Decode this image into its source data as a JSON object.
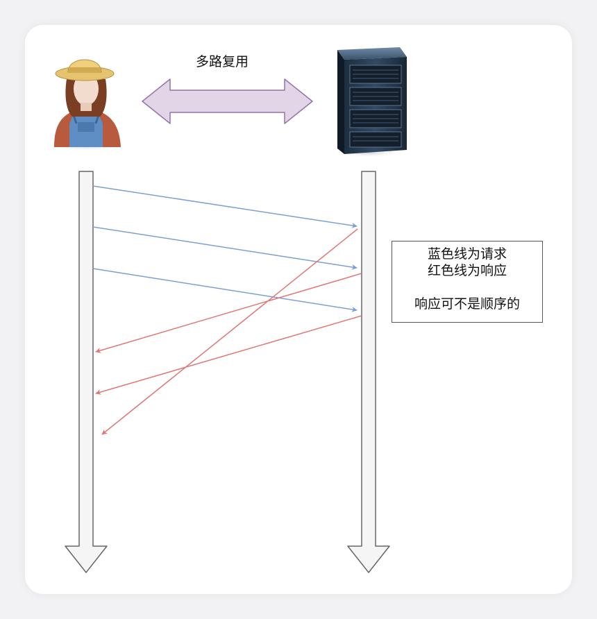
{
  "diagram": {
    "title": "多路复用",
    "legend": {
      "line1": "蓝色线为请求",
      "line2": "红色线为响应",
      "line3": "响应可不是顺序的"
    },
    "colors": {
      "request": "#7b9fd4",
      "response": "#e07676",
      "double_arrow_fill": "#e1d5e7",
      "double_arrow_stroke": "#9673a6",
      "timeline_fill": "#f5f5f5",
      "timeline_stroke": "#666666"
    },
    "icons": {
      "client": "farmer-person-icon",
      "server": "server-rack-icon"
    },
    "request_count": 3,
    "response_count": 3
  }
}
